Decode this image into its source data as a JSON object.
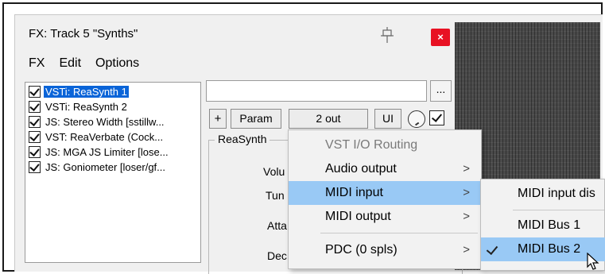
{
  "window": {
    "title": "FX: Track 5 \"Synths\"",
    "close_label": "×",
    "pin_icon": "pin-icon"
  },
  "menubar": [
    "FX",
    "Edit",
    "Options"
  ],
  "fx_list": [
    {
      "label": "VSTi: ReaSynth 1",
      "checked": true,
      "selected": true
    },
    {
      "label": "VSTi: ReaSynth 2",
      "checked": true,
      "selected": false
    },
    {
      "label": "JS: Stereo Width [sstillw...",
      "checked": true,
      "selected": false
    },
    {
      "label": "VST: ReaVerbate (Cock...",
      "checked": true,
      "selected": false
    },
    {
      "label": "JS: MGA JS Limiter [lose...",
      "checked": true,
      "selected": false
    },
    {
      "label": "JS: Goniometer [loser/gf...",
      "checked": true,
      "selected": false
    }
  ],
  "toolbar": {
    "preset_value": "",
    "dots_label": "...",
    "plus_label": "+",
    "param_label": "Param",
    "out_label": "2 out",
    "ui_label": "UI"
  },
  "plugin_panel": {
    "group_label": "ReaSynth",
    "params": [
      "Volu",
      "Tun",
      "Atta",
      "Dec"
    ]
  },
  "context_menu": {
    "header": "VST I/O Routing",
    "items": [
      {
        "label": "Audio output",
        "arrow": ">"
      },
      {
        "label": "MIDI input",
        "arrow": ">"
      },
      {
        "label": "MIDI output",
        "arrow": ">"
      },
      {
        "label": "PDC (0 spls)",
        "arrow": ">"
      }
    ]
  },
  "submenu": {
    "items": [
      {
        "label": "MIDI input dis"
      },
      {
        "label": "MIDI Bus 1"
      },
      {
        "label": "MIDI Bus 2",
        "checked": true
      }
    ]
  },
  "colors": {
    "selection": "#0a64d8",
    "menu_highlight": "#99c9f5",
    "close": "#e81123"
  }
}
